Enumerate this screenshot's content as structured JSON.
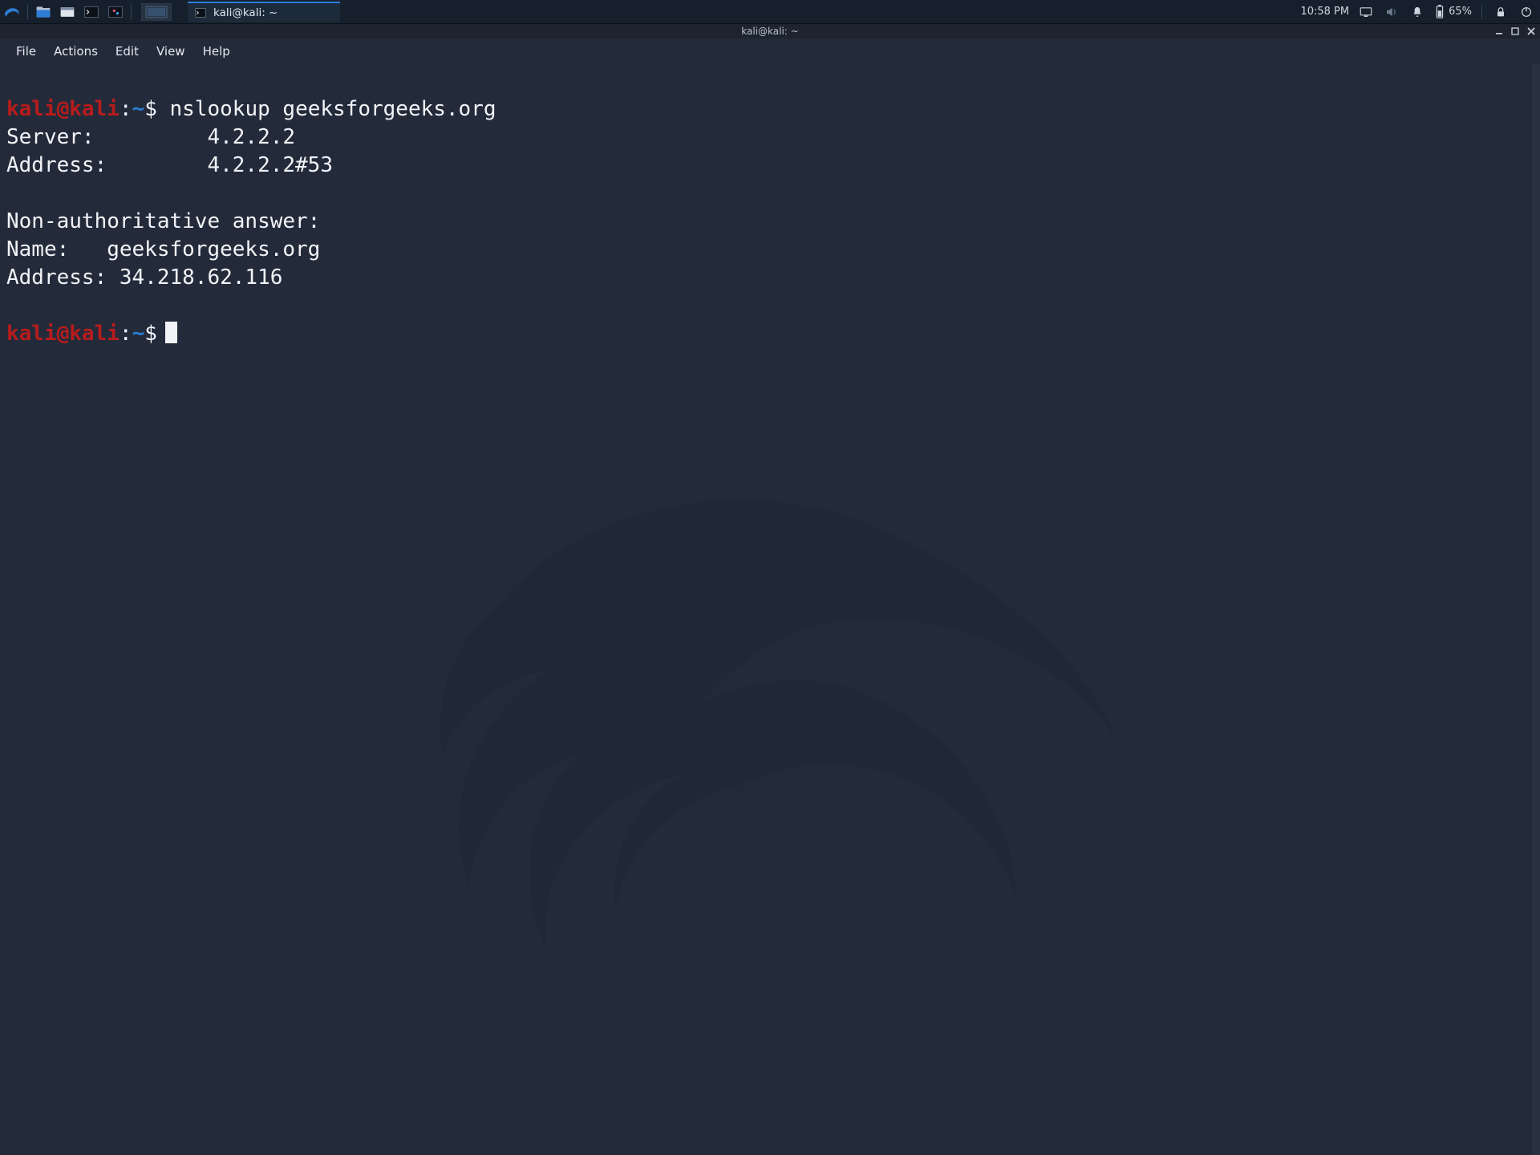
{
  "panel": {
    "taskbar_app_title": "kali@kali: ~",
    "clock": "10:58 PM",
    "battery_text": "65%"
  },
  "window": {
    "title": "kali@kali: ~"
  },
  "menubar": {
    "file": "File",
    "actions": "Actions",
    "edit": "Edit",
    "view": "View",
    "help": "Help"
  },
  "terminal": {
    "prompt_user": "kali",
    "prompt_at": "@",
    "prompt_host": "kali",
    "prompt_sep": ":",
    "prompt_path": "~",
    "prompt_dollar": "$",
    "command": "nslookup geeksforgeeks.org",
    "out1": "Server:         4.2.2.2",
    "out2": "Address:        4.2.2.2#53",
    "blank": "",
    "out3": "Non-authoritative answer:",
    "out4": "Name:   geeksforgeeks.org",
    "out5": "Address: 34.218.62.116"
  }
}
